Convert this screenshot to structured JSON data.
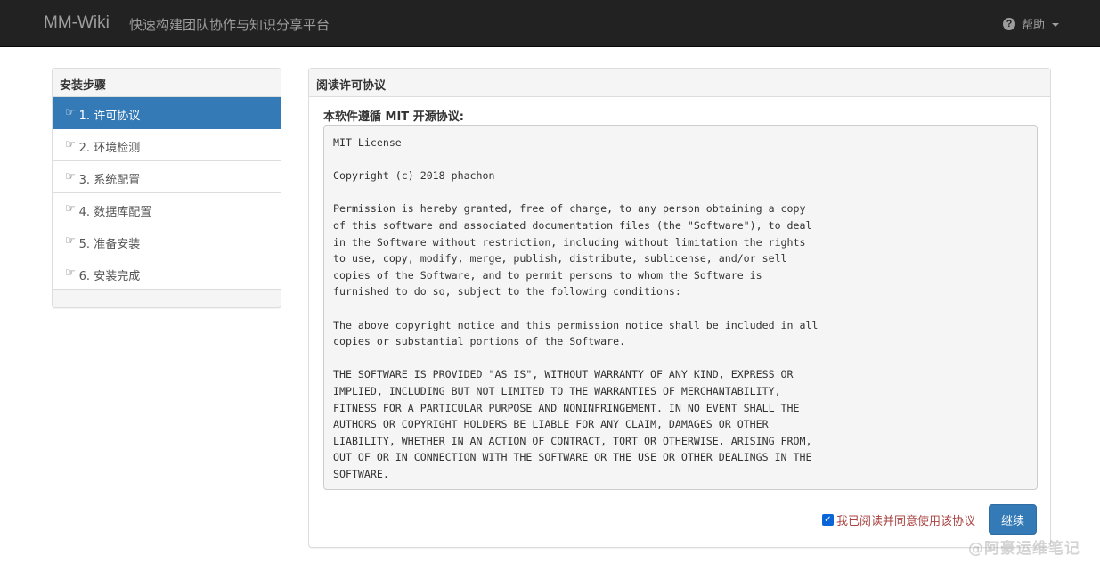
{
  "navbar": {
    "brand": "MM-Wiki",
    "subtitle": "快速构建团队协作与知识分享平台",
    "help_label": "帮助",
    "help_icon": "question-circle-icon"
  },
  "steps": {
    "title": "安装步骤",
    "icon": "hand-pointing-icon",
    "items": [
      {
        "label": "1. 许可协议",
        "active": true
      },
      {
        "label": "2. 环境检测",
        "active": false
      },
      {
        "label": "3. 系统配置",
        "active": false
      },
      {
        "label": "4. 数据库配置",
        "active": false
      },
      {
        "label": "5. 准备安装",
        "active": false
      },
      {
        "label": "6. 安装完成",
        "active": false
      }
    ]
  },
  "license": {
    "panel_title": "阅读许可协议",
    "intro": "本软件遵循 MIT 开源协议:",
    "text": "MIT License\n\nCopyright (c) 2018 phachon\n\nPermission is hereby granted, free of charge, to any person obtaining a copy\nof this software and associated documentation files (the \"Software\"), to deal\nin the Software without restriction, including without limitation the rights\nto use, copy, modify, merge, publish, distribute, sublicense, and/or sell\ncopies of the Software, and to permit persons to whom the Software is\nfurnished to do so, subject to the following conditions:\n\nThe above copyright notice and this permission notice shall be included in all\ncopies or substantial portions of the Software.\n\nTHE SOFTWARE IS PROVIDED \"AS IS\", WITHOUT WARRANTY OF ANY KIND, EXPRESS OR\nIMPLIED, INCLUDING BUT NOT LIMITED TO THE WARRANTIES OF MERCHANTABILITY,\nFITNESS FOR A PARTICULAR PURPOSE AND NONINFRINGEMENT. IN NO EVENT SHALL THE\nAUTHORS OR COPYRIGHT HOLDERS BE LIABLE FOR ANY CLAIM, DAMAGES OR OTHER\nLIABILITY, WHETHER IN AN ACTION OF CONTRACT, TORT OR OTHERWISE, ARISING FROM,\nOUT OF OR IN CONNECTION WITH THE SOFTWARE OR THE USE OR OTHER DEALINGS IN THE\nSOFTWARE.",
    "agree_label": "我已阅读并同意使用该协议",
    "agree_checked": true,
    "continue_label": "继续"
  },
  "watermark": "@阿豪运维笔记",
  "colors": {
    "navbar_bg": "#222222",
    "primary": "#337ab7",
    "agree_text": "#a94442"
  }
}
